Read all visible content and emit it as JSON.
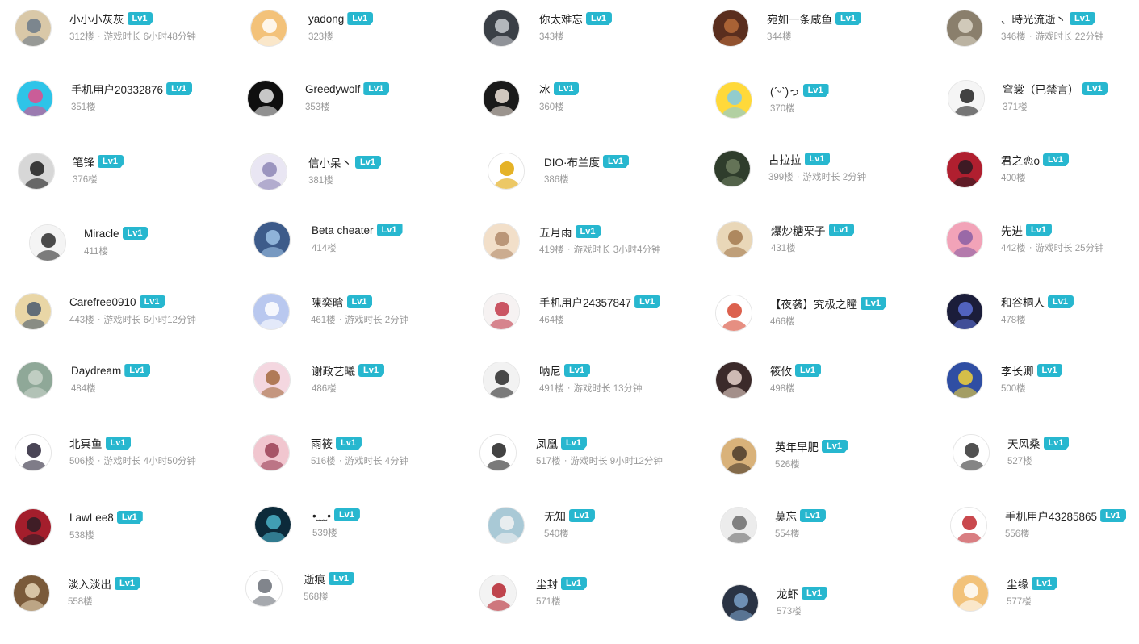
{
  "level_badge": "Lv1",
  "meta_separator": "·",
  "users": [
    {
      "name": "小小小灰灰",
      "floor": "312楼",
      "playtime": "游戏时长 6小时48分钟",
      "avatar_icon": "anime-girl-avatar",
      "avatar_colors": [
        "#d9c8a8",
        "#6b7a8a"
      ]
    },
    {
      "name": "yadong",
      "floor": "323楼",
      "playtime": "",
      "avatar_icon": "shiba-dog-avatar",
      "avatar_colors": [
        "#f3c27a",
        "#ffffff"
      ]
    },
    {
      "name": "你太难忘",
      "floor": "343楼",
      "playtime": "",
      "avatar_icon": "dark-figure-avatar",
      "avatar_colors": [
        "#3a3f46",
        "#c9ccd1"
      ]
    },
    {
      "name": "宛如一条咸鱼",
      "floor": "344楼",
      "playtime": "",
      "avatar_icon": "samurai-avatar",
      "avatar_colors": [
        "#5a2e1e",
        "#b76b3a"
      ]
    },
    {
      "name": "、時光流逝丶",
      "floor": "346楼",
      "playtime": "游戏时长 22分钟",
      "avatar_icon": "armored-warrior-avatar",
      "avatar_colors": [
        "#8a7f6c",
        "#dcd6c7"
      ]
    },
    {
      "name": "手机用户20332876",
      "floor": "351楼",
      "playtime": "",
      "avatar_icon": "miku-avatar",
      "avatar_colors": [
        "#2ec4e8",
        "#e54b8a"
      ]
    },
    {
      "name": "Greedywolf",
      "floor": "353楼",
      "playtime": "",
      "avatar_icon": "wolf-silhouette-avatar",
      "avatar_colors": [
        "#0f0f0f",
        "#e8e8e8"
      ]
    },
    {
      "name": "冰",
      "floor": "360楼",
      "playtime": "",
      "avatar_icon": "white-haired-girl-avatar",
      "avatar_colors": [
        "#1a1a1a",
        "#f1e6dc"
      ]
    },
    {
      "name": "(ˊᵕˋ)っ",
      "floor": "370楼",
      "playtime": "",
      "avatar_icon": "pikachu-avatar",
      "avatar_colors": [
        "#ffd93a",
        "#7fc9e8"
      ]
    },
    {
      "name": "穹裳（已禁言）",
      "floor": "371楼",
      "playtime": "",
      "avatar_icon": "sketch-character-avatar",
      "avatar_colors": [
        "#f5f5f5",
        "#222222"
      ]
    },
    {
      "name": "笔锋",
      "floor": "376楼",
      "playtime": "",
      "avatar_icon": "swordsman-avatar",
      "avatar_colors": [
        "#d7d7d7",
        "#1d1d1d"
      ]
    },
    {
      "name": "信小呆丶",
      "floor": "381楼",
      "playtime": "",
      "avatar_icon": "silver-hair-girl-avatar",
      "avatar_colors": [
        "#e9e6f3",
        "#8d86b5"
      ]
    },
    {
      "name": "DIO·布兰度",
      "floor": "386楼",
      "playtime": "",
      "avatar_icon": "dio-figure-avatar",
      "avatar_colors": [
        "#ffffff",
        "#e0a400"
      ]
    },
    {
      "name": "古拉拉",
      "floor": "399楼",
      "playtime": "游戏时长 2分钟",
      "avatar_icon": "dark-green-sphere-avatar",
      "avatar_colors": [
        "#2f3d2c",
        "#6d7d5f"
      ]
    },
    {
      "name": "君之恋o",
      "floor": "400楼",
      "playtime": "",
      "avatar_icon": "red-dress-girl-avatar",
      "avatar_colors": [
        "#b01f2f",
        "#2a1a22"
      ]
    },
    {
      "name": "Miracle",
      "floor": "411楼",
      "playtime": "",
      "avatar_icon": "boy-sitting-avatar",
      "avatar_colors": [
        "#f4f4f4",
        "#2c2c2c"
      ]
    },
    {
      "name": "Beta cheater",
      "floor": "414楼",
      "playtime": "",
      "avatar_icon": "blue-scene-avatar",
      "avatar_colors": [
        "#3d5b8a",
        "#9ec3e6"
      ]
    },
    {
      "name": "五月雨",
      "floor": "419楼",
      "playtime": "游戏时长 3小时4分钟",
      "avatar_icon": "blonde-girl-avatar",
      "avatar_colors": [
        "#f2dfc9",
        "#b08a6a"
      ]
    },
    {
      "name": "爆炒糖栗子",
      "floor": "431楼",
      "playtime": "",
      "avatar_icon": "cute-cat-avatar",
      "avatar_colors": [
        "#e9d7b8",
        "#a37a4f"
      ]
    },
    {
      "name": "先进",
      "floor": "442楼",
      "playtime": "游戏时长 25分钟",
      "avatar_icon": "pink-hair-girl-avatar",
      "avatar_colors": [
        "#f2a3b8",
        "#8b5fa3"
      ]
    },
    {
      "name": "Carefree0910",
      "floor": "443楼",
      "playtime": "游戏时长 6小时12分钟",
      "avatar_icon": "blonde-anime-avatar",
      "avatar_colors": [
        "#e9d6a6",
        "#4a5a6e"
      ]
    },
    {
      "name": "陳奕晗",
      "floor": "461楼",
      "playtime": "游戏时长 2分钟",
      "avatar_icon": "blue-hair-girl-avatar",
      "avatar_colors": [
        "#b9c8ef",
        "#ffffff"
      ]
    },
    {
      "name": "手机用户24357847",
      "floor": "464楼",
      "playtime": "",
      "avatar_icon": "white-hair-girl-avatar",
      "avatar_colors": [
        "#f6f2f2",
        "#c23a4a"
      ]
    },
    {
      "name": "【夜袭】究极之瞳",
      "floor": "466楼",
      "playtime": "",
      "avatar_icon": "fox-cartoon-avatar",
      "avatar_colors": [
        "#ffffff",
        "#d6452f"
      ]
    },
    {
      "name": "和谷桐人",
      "floor": "478楼",
      "playtime": "",
      "avatar_icon": "dark-swordsman-avatar",
      "avatar_colors": [
        "#1b1d3a",
        "#5b6fd6"
      ]
    },
    {
      "name": "Daydream",
      "floor": "484楼",
      "playtime": "",
      "avatar_icon": "green-mist-avatar",
      "avatar_colors": [
        "#8fa898",
        "#c9d4c9"
      ]
    },
    {
      "name": "谢政艺曦",
      "floor": "486楼",
      "playtime": "",
      "avatar_icon": "maid-girl-avatar",
      "avatar_colors": [
        "#f4d7e0",
        "#a36a3e"
      ]
    },
    {
      "name": "呐尼",
      "floor": "491楼",
      "playtime": "游戏时长 13分钟",
      "avatar_icon": "manga-couple-avatar",
      "avatar_colors": [
        "#f2f2f2",
        "#2a2a2a"
      ]
    },
    {
      "name": "筱攸",
      "floor": "498楼",
      "playtime": "",
      "avatar_icon": "dark-hair-girl-avatar",
      "avatar_colors": [
        "#3b2a2a",
        "#e9d3cc"
      ]
    },
    {
      "name": "李长卿",
      "floor": "500楼",
      "playtime": "",
      "avatar_icon": "boy-photo-avatar",
      "avatar_colors": [
        "#2f4ea3",
        "#f2d23a"
      ]
    },
    {
      "name": "北冥鱼",
      "floor": "506楼",
      "playtime": "游戏时长 4小时50分钟",
      "avatar_icon": "gothic-girl-avatar",
      "avatar_colors": [
        "#ffffff",
        "#2a2438"
      ]
    },
    {
      "name": "雨筱",
      "floor": "516楼",
      "playtime": "游戏时长 4分钟",
      "avatar_icon": "flower-girl-avatar",
      "avatar_colors": [
        "#f1c6cf",
        "#9a3f55"
      ]
    },
    {
      "name": "凤凰",
      "floor": "517楼",
      "playtime": "游戏时长 9小时12分钟",
      "avatar_icon": "sleeping-sketch-avatar",
      "avatar_colors": [
        "#ffffff",
        "#222222"
      ]
    },
    {
      "name": "英年早肥",
      "floor": "526楼",
      "playtime": "",
      "avatar_icon": "cheetah-avatar",
      "avatar_colors": [
        "#d9b27a",
        "#4a3a2a"
      ]
    },
    {
      "name": "天风桑",
      "floor": "527楼",
      "playtime": "",
      "avatar_icon": "doodle-face-avatar",
      "avatar_colors": [
        "#ffffff",
        "#333333"
      ]
    },
    {
      "name": "LawLee8",
      "floor": "538楼",
      "playtime": "",
      "avatar_icon": "red-warrior-avatar",
      "avatar_colors": [
        "#a41e2c",
        "#2e1d26"
      ]
    },
    {
      "name": "•﹏•",
      "floor": "539楼",
      "playtime": "",
      "avatar_icon": "starry-night-avatar",
      "avatar_colors": [
        "#0c2a3a",
        "#4bb3c9"
      ]
    },
    {
      "name": "无知",
      "floor": "540楼",
      "playtime": "",
      "avatar_icon": "note-photo-avatar",
      "avatar_colors": [
        "#a9c9d6",
        "#f3f3f3"
      ]
    },
    {
      "name": "莫忘",
      "floor": "554楼",
      "playtime": "",
      "avatar_icon": "lion-sketch-avatar",
      "avatar_colors": [
        "#ececec",
        "#6d6d6d"
      ]
    },
    {
      "name": "手机用户43285865",
      "floor": "556楼",
      "playtime": "",
      "avatar_icon": "kabuki-mask-avatar",
      "avatar_colors": [
        "#ffffff",
        "#c0282e"
      ]
    },
    {
      "name": "淡入淡出",
      "floor": "558楼",
      "playtime": "",
      "avatar_icon": "pocket-watch-avatar",
      "avatar_colors": [
        "#7a5a3a",
        "#e8d7b8"
      ]
    },
    {
      "name": "逝痕",
      "floor": "568楼",
      "playtime": "",
      "avatar_icon": "hippo-cartoon-avatar",
      "avatar_colors": [
        "#ffffff",
        "#6b7078"
      ]
    },
    {
      "name": "尘封",
      "floor": "571楼",
      "playtime": "",
      "avatar_icon": "white-hair-boy-avatar",
      "avatar_colors": [
        "#f3f3f3",
        "#b5252f"
      ]
    },
    {
      "name": "龙虾",
      "floor": "573楼",
      "playtime": "",
      "avatar_icon": "person-photo-avatar",
      "avatar_colors": [
        "#2a3344",
        "#7aa0c8"
      ]
    },
    {
      "name": "尘缘",
      "floor": "577楼",
      "playtime": "",
      "avatar_icon": "shiba-dog-avatar",
      "avatar_colors": [
        "#f2c27a",
        "#ffffff"
      ]
    }
  ]
}
